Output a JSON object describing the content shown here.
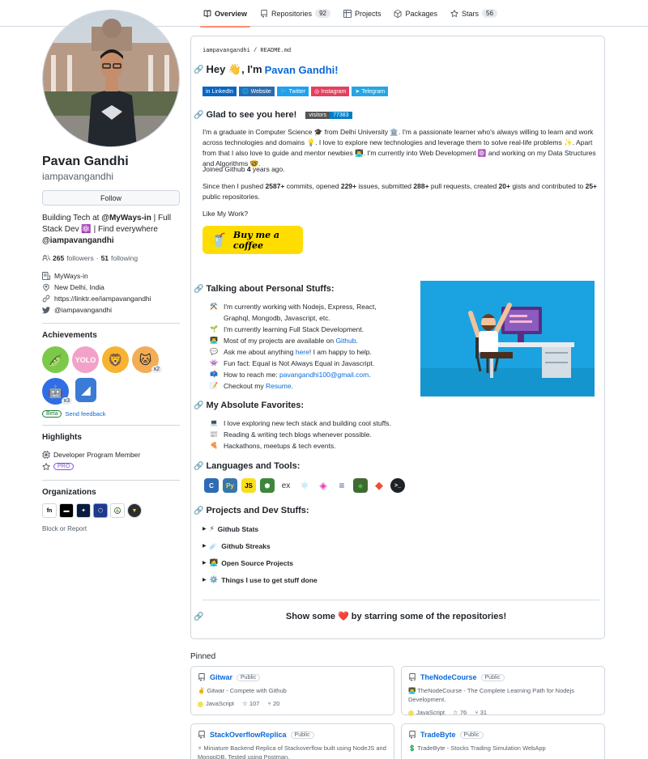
{
  "tabs": [
    {
      "label": "Overview",
      "count": "",
      "icon": "book-icon"
    },
    {
      "label": "Repositories",
      "count": "92",
      "icon": "repo-icon"
    },
    {
      "label": "Projects",
      "count": "",
      "icon": "table-icon"
    },
    {
      "label": "Packages",
      "count": "",
      "icon": "package-icon"
    },
    {
      "label": "Stars",
      "count": "56",
      "icon": "star-icon"
    }
  ],
  "profile": {
    "fullname": "Pavan Gandhi",
    "username": "iampavangandhi",
    "follow_label": "Follow",
    "bio_a": "Building Tech at ",
    "bio_b": "@MyWays-in",
    "bio_c": " | Full Stack Dev ⚛️ | Find everywhere ",
    "bio_d": "@iampavangandhi",
    "followers": "265",
    "followers_label": "followers",
    "following": "51",
    "following_label": "following",
    "company": "MyWays-in",
    "location": "New Delhi, India",
    "website": "https://linktr.ee/iampavangandhi",
    "twitter": "@iampavangandhi"
  },
  "achievements": {
    "title": "Achievements",
    "items": [
      {
        "emoji": "🫛",
        "bg": "#7cc94a",
        "count": ""
      },
      {
        "emoji": "YOLO",
        "bg": "#f2a2c8",
        "count": ""
      },
      {
        "emoji": "🦁",
        "bg": "#f7b431",
        "count": ""
      },
      {
        "emoji": "🐱",
        "bg": "#f2ad55",
        "count": "x2"
      },
      {
        "emoji": "🤖",
        "bg": "#2f6ee6",
        "count": "x3"
      },
      {
        "emoji": "◢",
        "bg": "#3a7bd5",
        "count": ""
      }
    ],
    "beta": "Beta",
    "feedback": "Send feedback"
  },
  "highlights": {
    "title": "Highlights",
    "member": "Developer Program Member",
    "pro": "PRO"
  },
  "organizations": {
    "title": "Organizations",
    "block": "Block or Report"
  },
  "readme": {
    "path_user": "iampavangandhi",
    "path_file": "README.md",
    "hey": "Hey 👋, I'm ",
    "hey_name": "Pavan Gandhi!",
    "socials": [
      {
        "label": "LinkedIn",
        "color": "#0a66c2"
      },
      {
        "label": "Website",
        "color": "#2b6cb0"
      },
      {
        "label": "Twitter",
        "color": "#1da1f2"
      },
      {
        "label": "Instagram",
        "color": "#e4405f"
      },
      {
        "label": "Telegram",
        "color": "#26a5e4"
      }
    ],
    "glad": "Glad to see you here!",
    "visitors_label": "visitors",
    "visitors_count": "77383",
    "intro": "I'm a graduate in Computer Science 🎓 from Delhi University 🏛️. I'm a passionate learner who's always willing to learn and work across technologies and domains 💡. I love to explore new technologies and leverage them to solve real-life problems ✨. Apart from that I also love to guide and mentor newbies 👨‍💻. I'm currently into Web Development ⚛️ and working on my Data Structures and Algorithms 🤓.",
    "joined_a": "Joined Github ",
    "joined_b": "4",
    "joined_c": " years ago.",
    "since": {
      "t1": "Since then I pushed ",
      "n1": "2587+",
      "t2": " commits, opened ",
      "n2": "229+",
      "t3": " issues, submitted ",
      "n3": "288+",
      "t4": " pull requests, created ",
      "n4": "20+",
      "t5": " gists and contributed to ",
      "n5": "25+",
      "t6": " public repositories."
    },
    "like": "Like My Work?",
    "bmac": "Buy me a coffee",
    "personal_title": "Talking about Personal Stuffs:",
    "personal": [
      {
        "emoji": "⚒️",
        "a": "I'm currently working with Nodejs, Express, React, Graphql, Mongodb, Javascript, etc.",
        "link": "",
        "b": ""
      },
      {
        "emoji": "🌱",
        "a": "I'm currently learning Full Stack Development.",
        "link": "",
        "b": ""
      },
      {
        "emoji": "👨‍💻",
        "a": "Most of my projects are available on ",
        "link": "Github",
        "b": "."
      },
      {
        "emoji": "💬",
        "a": "Ask me about anything ",
        "link": "here",
        "b": "! I am happy to help."
      },
      {
        "emoji": "👾",
        "a": "Fun fact: Equal is Not Always Equal in Javascript.",
        "link": "",
        "b": ""
      },
      {
        "emoji": "📫",
        "a": "How to reach me: ",
        "link": "pavangandhi100@gmail.com",
        "b": "."
      },
      {
        "emoji": "📝",
        "a": "Checkout my ",
        "link": "Resume",
        "b": "."
      }
    ],
    "fav_title": "My Absolute Favorites:",
    "favorites": [
      {
        "emoji": "💻",
        "text": "I love exploring new tech stack and building cool stuffs."
      },
      {
        "emoji": "📰",
        "text": "Reading & writing tech blogs whenever possible."
      },
      {
        "emoji": "🍕",
        "text": "Hackathons, meetups & tech events."
      }
    ],
    "lang_title": "Languages and Tools:",
    "langs": [
      {
        "label": "C",
        "color": "#2f6ab5"
      },
      {
        "label": "Py",
        "color": "#3776ab"
      },
      {
        "label": "JS",
        "color": "#f7df1e"
      },
      {
        "label": "⬢",
        "color": "#3c873a"
      },
      {
        "label": "ex",
        "color": "#ffffff"
      },
      {
        "label": "⚛",
        "color": "#ffffff"
      },
      {
        "label": "◈",
        "color": "#ffffff"
      },
      {
        "label": "≡",
        "color": "#ffffff"
      },
      {
        "label": "◆",
        "color": "#4db33d"
      },
      {
        "label": "◆",
        "color": "#f05032"
      },
      {
        "label": ">_",
        "color": "#1f2328"
      }
    ],
    "proj_title": "Projects and Dev Stuffs:",
    "details": [
      {
        "emoji": "⚡",
        "text": "Github Stats"
      },
      {
        "emoji": "☄️",
        "text": "Github Streaks"
      },
      {
        "emoji": "🧑‍💻",
        "text": "Open Source Projects"
      },
      {
        "emoji": "⚙️",
        "text": "Things I use to get stuff done"
      }
    ],
    "show_a": "Show some ",
    "show_heart": "❤️",
    "show_b": " by starring some of the repositories!"
  },
  "pinned": {
    "title": "Pinned",
    "repos": [
      {
        "name": "Gitwar",
        "vis": "Public",
        "desc": "✌️ Gitwar - Compete with Github",
        "lang": "JavaScript",
        "stars": "107",
        "forks": "20"
      },
      {
        "name": "TheNodeCourse",
        "vis": "Public",
        "desc": "👨‍💻 TheNodeCourse - The Complete Learning Path for Nodejs Development.",
        "lang": "JavaScript",
        "stars": "76",
        "forks": "31"
      },
      {
        "name": "StackOverflowReplica",
        "vis": "Public",
        "desc": "⚡ Miniature Backend Replica of Stackoverflow built using NodeJS and MongoDB. Tested using Postman.",
        "lang": "",
        "stars": "",
        "forks": ""
      },
      {
        "name": "TradeByte",
        "vis": "Public",
        "desc": "💲 TradeByte - Stocks Trading Simulation WebApp",
        "lang": "",
        "stars": "",
        "forks": ""
      }
    ]
  }
}
